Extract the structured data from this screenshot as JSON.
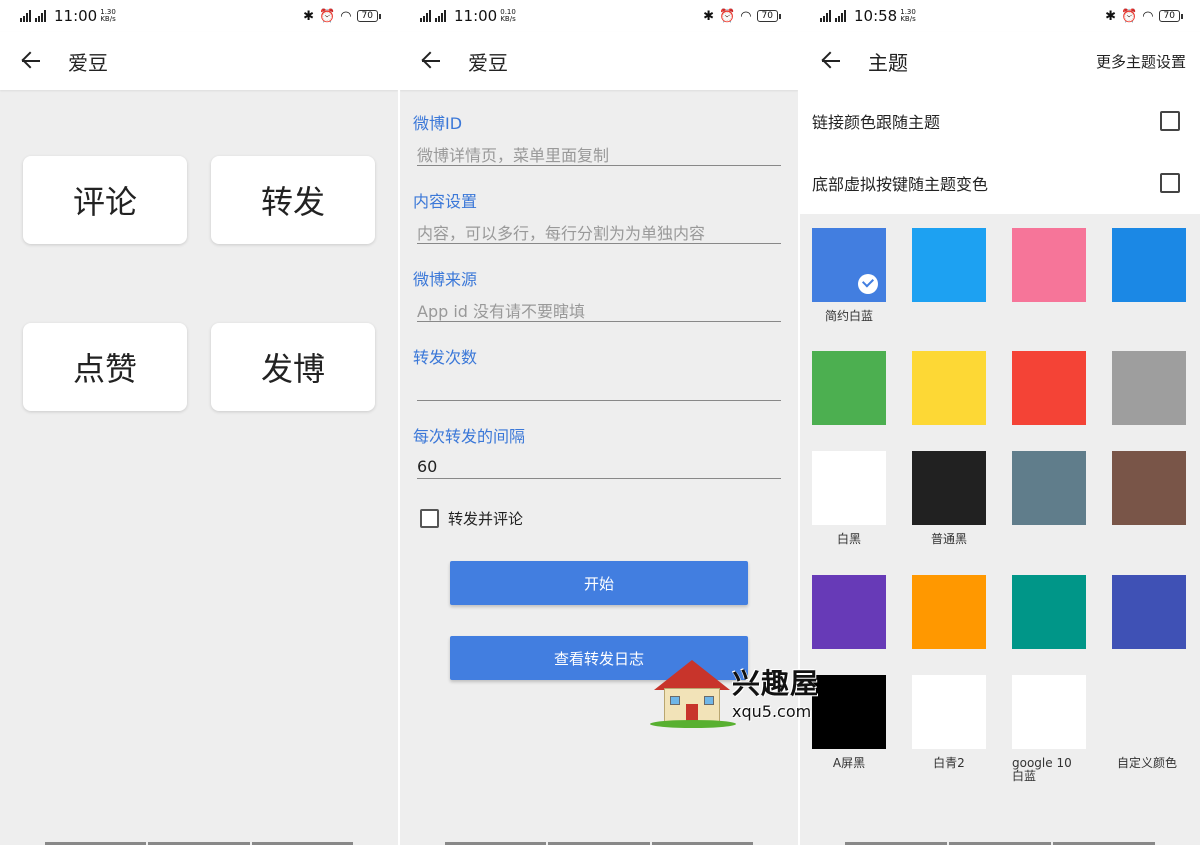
{
  "screen1": {
    "status": {
      "time": "11:00",
      "speed_value": "1.30",
      "speed_unit": "KB/s",
      "network": "4G",
      "battery": "70"
    },
    "title": "爱豆",
    "buttons": [
      "评论",
      "转发",
      "点赞",
      "发博"
    ]
  },
  "screen2": {
    "status": {
      "time": "11:00",
      "speed_value": "0.10",
      "speed_unit": "KB/s",
      "network": "4G",
      "battery": "70"
    },
    "title": "爱豆",
    "fields": [
      {
        "label": "微博ID",
        "placeholder": "微博详情页，菜单里面复制",
        "value": ""
      },
      {
        "label": "内容设置",
        "placeholder": "内容，可以多行，每行分割为为单独内容",
        "value": ""
      },
      {
        "label": "微博来源",
        "placeholder": "App id 没有请不要瞎填",
        "value": ""
      },
      {
        "label": "转发次数",
        "placeholder": "",
        "value": ""
      },
      {
        "label": "每次转发的间隔",
        "placeholder": "",
        "value": "60"
      }
    ],
    "checkbox_label": "转发并评论",
    "start_label": "开始",
    "log_label": "查看转发日志"
  },
  "screen3": {
    "status": {
      "time": "10:58",
      "speed_value": "1.30",
      "speed_unit": "KB/s",
      "network": "4G",
      "battery": "70"
    },
    "title": "主题",
    "action": "更多主题设置",
    "settings": [
      "链接颜色跟随主题",
      "底部虚拟按键随主题变色"
    ],
    "themes": [
      {
        "color": "#427ee0",
        "label": "简约白蓝",
        "selected": true
      },
      {
        "color": "#1da1f2",
        "label": ""
      },
      {
        "color": "#f67599",
        "label": ""
      },
      {
        "color": "#1b88e5",
        "label": ""
      },
      {
        "color": "#4caf50",
        "label": ""
      },
      {
        "color": "#fdd835",
        "label": ""
      },
      {
        "color": "#f44336",
        "label": ""
      },
      {
        "color": "#9e9e9e",
        "label": ""
      },
      {
        "color": "#ffffff",
        "label": "白黑"
      },
      {
        "color": "#212121",
        "label": "普通黑"
      },
      {
        "color": "#607d8b",
        "label": ""
      },
      {
        "color": "#795548",
        "label": ""
      },
      {
        "color": "#673ab7",
        "label": ""
      },
      {
        "color": "#ff9800",
        "label": ""
      },
      {
        "color": "#009688",
        "label": ""
      },
      {
        "color": "#3f51b5",
        "label": ""
      },
      {
        "color": "#000000",
        "label": "A屏黑"
      },
      {
        "color": "#ffffff",
        "label": "白青2"
      },
      {
        "color": "#ffffff",
        "label": "google 10 白蓝"
      },
      {
        "color": "",
        "label": "自定义颜色"
      }
    ]
  },
  "watermark": {
    "cn": "兴趣屋",
    "en": "xqu5.com"
  }
}
